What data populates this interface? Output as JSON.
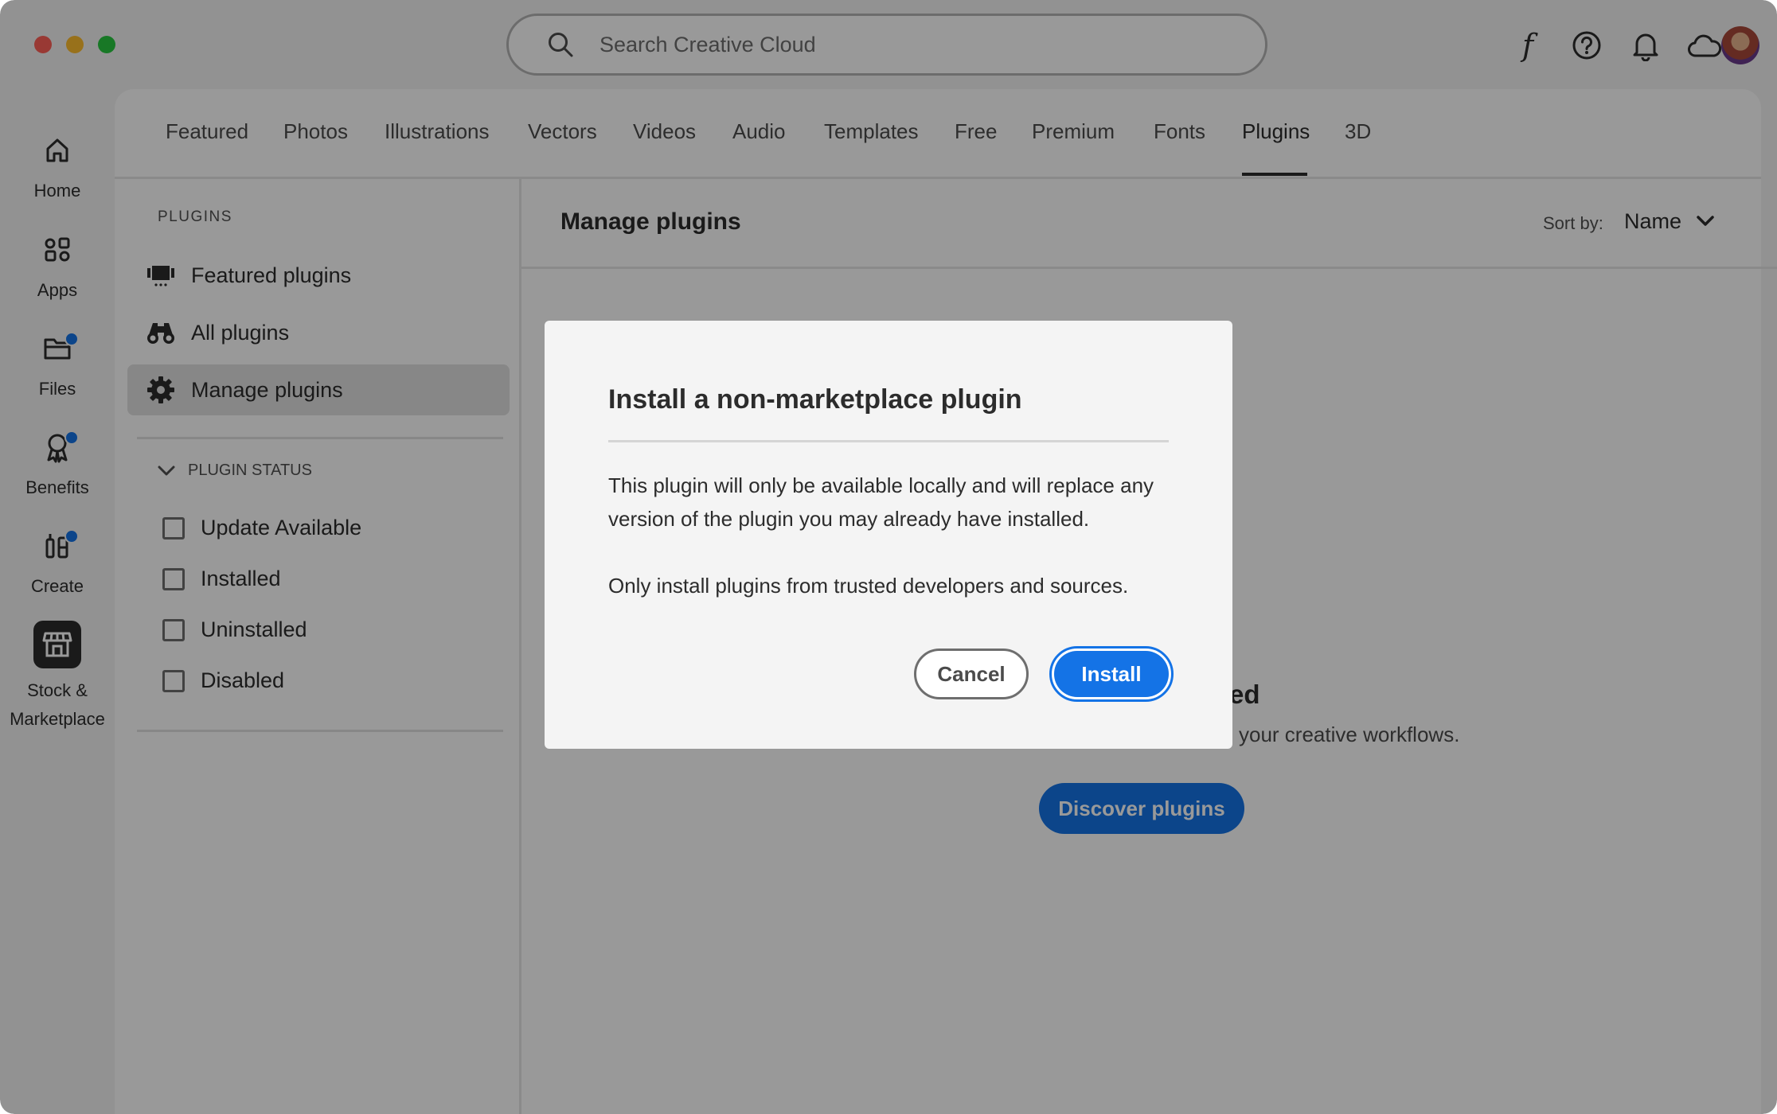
{
  "titlebar": {
    "search_placeholder": "Search Creative Cloud",
    "icons": [
      "fonts-icon",
      "help-icon",
      "bell-icon",
      "cloud-icon",
      "avatar"
    ],
    "font_glyph": "f"
  },
  "rail": {
    "items": [
      {
        "label": "Home",
        "icon": "home-icon",
        "dot": false
      },
      {
        "label": "Apps",
        "icon": "apps-icon",
        "dot": false
      },
      {
        "label": "Files",
        "icon": "folder-icon",
        "dot": true
      },
      {
        "label": "Benefits",
        "icon": "ribbon-icon",
        "dot": true
      },
      {
        "label": "Create",
        "icon": "create-icon",
        "dot": true
      },
      {
        "label": "Stock &",
        "label2": "Marketplace",
        "icon": "store-icon",
        "active": true
      }
    ]
  },
  "tabs": [
    "Featured",
    "Photos",
    "Illustrations",
    "Vectors",
    "Videos",
    "Audio",
    "Templates",
    "Free",
    "Premium",
    "Fonts",
    "Plugins",
    "3D"
  ],
  "active_tab": "Plugins",
  "sidebar": {
    "heading": "PLUGINS",
    "items": [
      {
        "label": "Featured plugins",
        "icon": "featured-icon"
      },
      {
        "label": "All plugins",
        "icon": "binoculars-icon"
      },
      {
        "label": "Manage plugins",
        "icon": "gear-icon",
        "active": true
      }
    ],
    "status_heading": "PLUGIN STATUS",
    "filters": [
      "Update Available",
      "Installed",
      "Uninstalled",
      "Disabled"
    ]
  },
  "main": {
    "title": "Manage plugins",
    "sort_label": "Sort by:",
    "sort_value": "Name",
    "empty_title_fragment": "ed",
    "empty_desc_fragment": "your creative workflows.",
    "discover_label": "Discover plugins"
  },
  "dialog": {
    "title": "Install a non-marketplace plugin",
    "body1": "This plugin will only be available locally and will replace any version of the plugin you may already have installed.",
    "body2": "Only install plugins from trusted developers and sources.",
    "cancel_label": "Cancel",
    "install_label": "Install"
  },
  "colors": {
    "accent": "#1473e6",
    "traffic_red": "#ff5f57",
    "traffic_yellow": "#febc2e",
    "traffic_green": "#28c840",
    "overlay": "rgba(0,0,0,0.4)"
  }
}
